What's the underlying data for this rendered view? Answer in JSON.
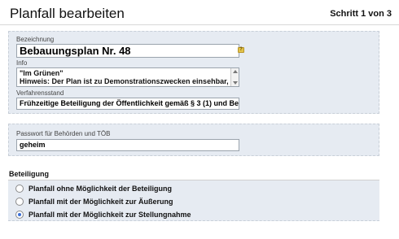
{
  "header": {
    "title": "Planfall bearbeiten",
    "step": "Schritt 1 von 3"
  },
  "form": {
    "bezeichnung_label": "Bezeichnung",
    "bezeichnung_value": "Bebauungsplan Nr. 48",
    "info_label": "Info",
    "info_line1": "\"Im Grünen\"",
    "info_line2": "Hinweis: Der Plan ist zu Demonstrationszwecken einsehbar,",
    "verfahrensstand_label": "Verfahrensstand",
    "verfahrensstand_value": "Frühzeitige Beteiligung der Öffentlichkeit gemäß § 3 (1) und Beteil",
    "passwort_label": "Passwort für Behörden und TÖB",
    "passwort_value": "geheim",
    "help_symbol": "?"
  },
  "beteiligung": {
    "title": "Beteiligung",
    "options": [
      {
        "label": "Planfall ohne Möglichkeit der Beteiligung",
        "selected": false
      },
      {
        "label": "Planfall mit der Möglichkeit zur Äußerung",
        "selected": false
      },
      {
        "label": "Planfall mit der Möglichkeit zur Stellungnahme",
        "selected": true
      }
    ]
  },
  "colors": {
    "panel_bg": "#e6ebf2",
    "help_icon": "#e3c34a",
    "radio_selected": "#3a6fd8"
  }
}
